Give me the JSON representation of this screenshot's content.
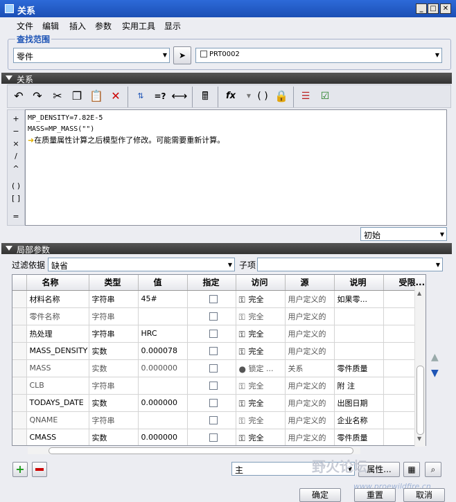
{
  "window": {
    "title": "关系"
  },
  "menu": [
    "文件",
    "编辑",
    "插入",
    "参数",
    "实用工具",
    "显示"
  ],
  "scope": {
    "label": "查找范围",
    "type_value": "零件",
    "model_value": "PRT0002"
  },
  "relations_section": {
    "label": "关系"
  },
  "editor": {
    "lines": [
      "MP_DENSITY=7.82E-5",
      "MASS=MP_MASS(\"\")"
    ],
    "warning": "在质量属性计算之后模型作了修改。可能需要重新计算。"
  },
  "view_combo": {
    "value": "初始"
  },
  "local_params_section": {
    "label": "局部参数"
  },
  "filter": {
    "label": "过滤依据",
    "value": "缺省",
    "subitem_label": "子项",
    "subitem_value": ""
  },
  "table": {
    "headers": [
      "名称",
      "类型",
      "值",
      "指定",
      "访问",
      "源",
      "说明",
      "受限..."
    ],
    "rows": [
      {
        "name": "材料名称",
        "type": "字符串",
        "value": "45#",
        "access": "完全",
        "source": "用户定义的",
        "desc": "如果零...",
        "editable": true
      },
      {
        "name": "零件名称",
        "type": "字符串",
        "value": "",
        "access": "完全",
        "source": "用户定义的",
        "desc": "",
        "editable": false
      },
      {
        "name": "热处理",
        "type": "字符串",
        "value": "HRC",
        "access": "完全",
        "source": "用户定义的",
        "desc": "",
        "editable": true
      },
      {
        "name": "MASS_DENSITY",
        "type": "实数",
        "value": "0.000078",
        "access": "完全",
        "source": "用户定义的",
        "desc": "",
        "editable": true
      },
      {
        "name": "MASS",
        "type": "实数",
        "value": "0.000000",
        "access": "锁定 ...",
        "source": "关系",
        "desc": "零件质量",
        "editable": false
      },
      {
        "name": "CLB",
        "type": "字符串",
        "value": "",
        "access": "完全",
        "source": "用户定义的",
        "desc": "附 注",
        "editable": false
      },
      {
        "name": "TODAYS_DATE",
        "type": "实数",
        "value": "0.000000",
        "access": "完全",
        "source": "用户定义的",
        "desc": "出图日期",
        "editable": true
      },
      {
        "name": "QNAME",
        "type": "字符串",
        "value": "",
        "access": "完全",
        "source": "用户定义的",
        "desc": "企业名称",
        "editable": false
      },
      {
        "name": "CMASS",
        "type": "实数",
        "value": "0.000000",
        "access": "完全",
        "source": "用户定义的",
        "desc": "零件质量",
        "editable": true
      }
    ]
  },
  "bottom": {
    "main_value": "主",
    "attributes_label": "属性..."
  },
  "footer": {
    "ok": "确定",
    "reset": "重置",
    "cancel": "取消"
  },
  "watermark": {
    "text": "野火论坛",
    "url": "www.proewildfire.cn"
  }
}
